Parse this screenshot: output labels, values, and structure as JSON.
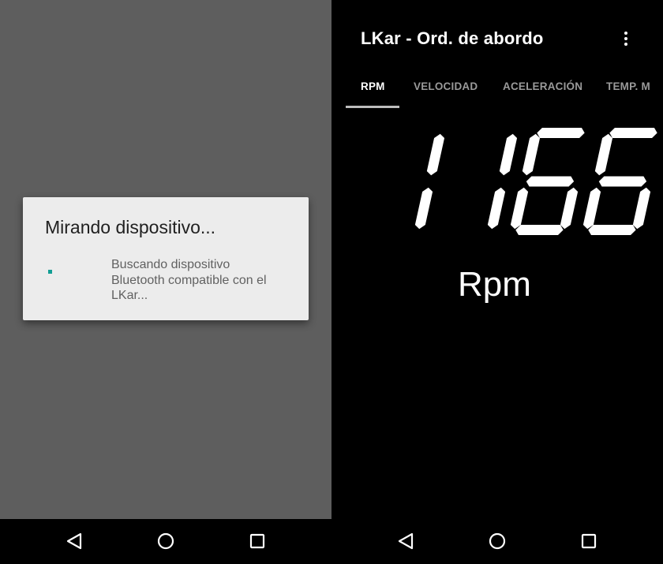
{
  "left": {
    "dialog": {
      "title": "Mirando dispositivo...",
      "message": "Buscando dispositivo\nBluetooth compatible con el\nLKar..."
    }
  },
  "right": {
    "app_title": "LKar - Ord. de abordo",
    "tabs": [
      {
        "label": "RPM",
        "active": true
      },
      {
        "label": "VELOCIDAD",
        "active": false
      },
      {
        "label": "ACELERACIÓN",
        "active": false
      },
      {
        "label": "TEMP. M",
        "active": false
      }
    ],
    "rpm_value": "1166",
    "unit": "Rpm"
  },
  "nav": {
    "icons": [
      "back-icon",
      "home-icon",
      "recents-icon"
    ]
  },
  "colors": {
    "spinner": "#129e94",
    "dialog_bg": "#ececec",
    "backdrop": "#5e5e5e",
    "tab_indicator": "#bdbdbd"
  }
}
